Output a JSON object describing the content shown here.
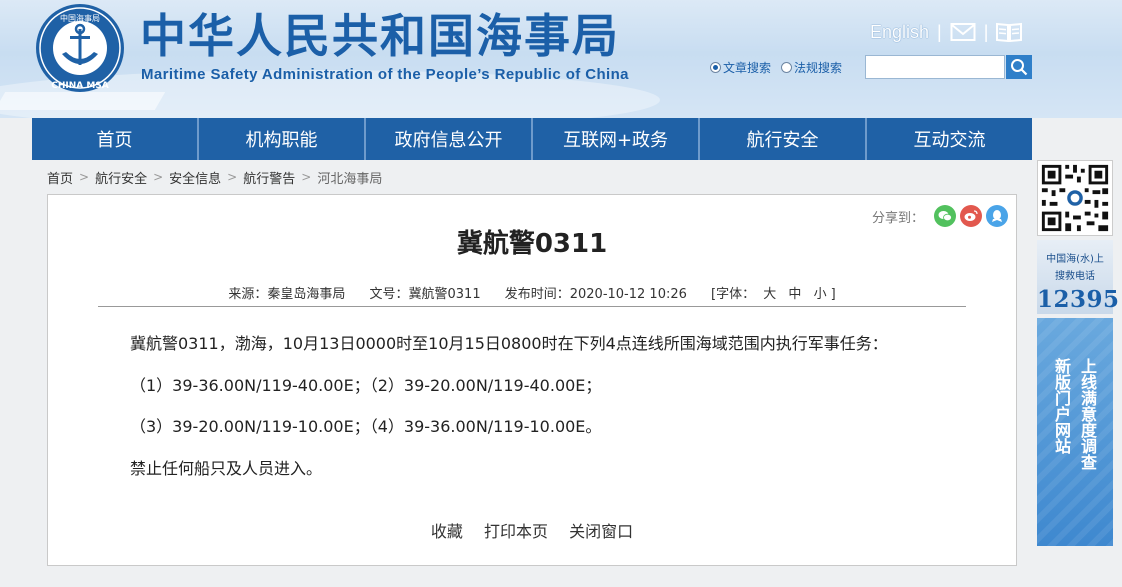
{
  "header": {
    "title_cn": "中华人民共和国海事局",
    "title_en": "Maritime Safety Administration of the People’s Republic of China",
    "logo_text_top": "中国海事局",
    "logo_text_bottom": "CHINA MSA",
    "english_link": "English",
    "search_options": [
      "文章搜索",
      "法规搜索"
    ],
    "search_selected": 0,
    "search_placeholder": ""
  },
  "nav": {
    "items": [
      "首页",
      "机构职能",
      "政府信息公开",
      "互联网+政务",
      "航行安全",
      "互动交流"
    ]
  },
  "breadcrumb": {
    "items": [
      "首页",
      "航行安全",
      "安全信息",
      "航行警告",
      "河北海事局"
    ],
    "separator": ">"
  },
  "article": {
    "share_label": "分享到：",
    "title": "冀航警0311",
    "source": "来源：秦皇岛海事局",
    "doc_no": "文号：冀航警0311",
    "publish_time": "发布时间：2020-10-12 10:26",
    "font_label": "[字体：",
    "font_large": "大",
    "font_medium": "中",
    "font_small": "小",
    "font_end": "]",
    "paragraphs": [
      "冀航警0311，渤海，10月13日0000时至10月15日0800时在下列4点连线所围海域范围内执行军事任务：",
      "（1）39-36.00N/119-40.00E；（2）39-20.00N/119-40.00E；",
      "（3）39-20.00N/119-10.00E；（4）39-36.00N/119-10.00E。",
      "禁止任何船只及人员进入。"
    ],
    "actions": [
      "收藏",
      "打印本页",
      "关闭窗口"
    ]
  },
  "sidebar": {
    "hotline_line1": "中国海(水)上",
    "hotline_line2": "搜救电话",
    "hotline_number": "12395",
    "survey_col1": "新版门户网站",
    "survey_col2": "上线满意度调查"
  },
  "colors": {
    "brand_blue": "#1b5fa8",
    "nav_blue": "#1f61a6",
    "wechat": "#52c15e",
    "weibo": "#e2584e",
    "qq": "#4aa4e8"
  }
}
